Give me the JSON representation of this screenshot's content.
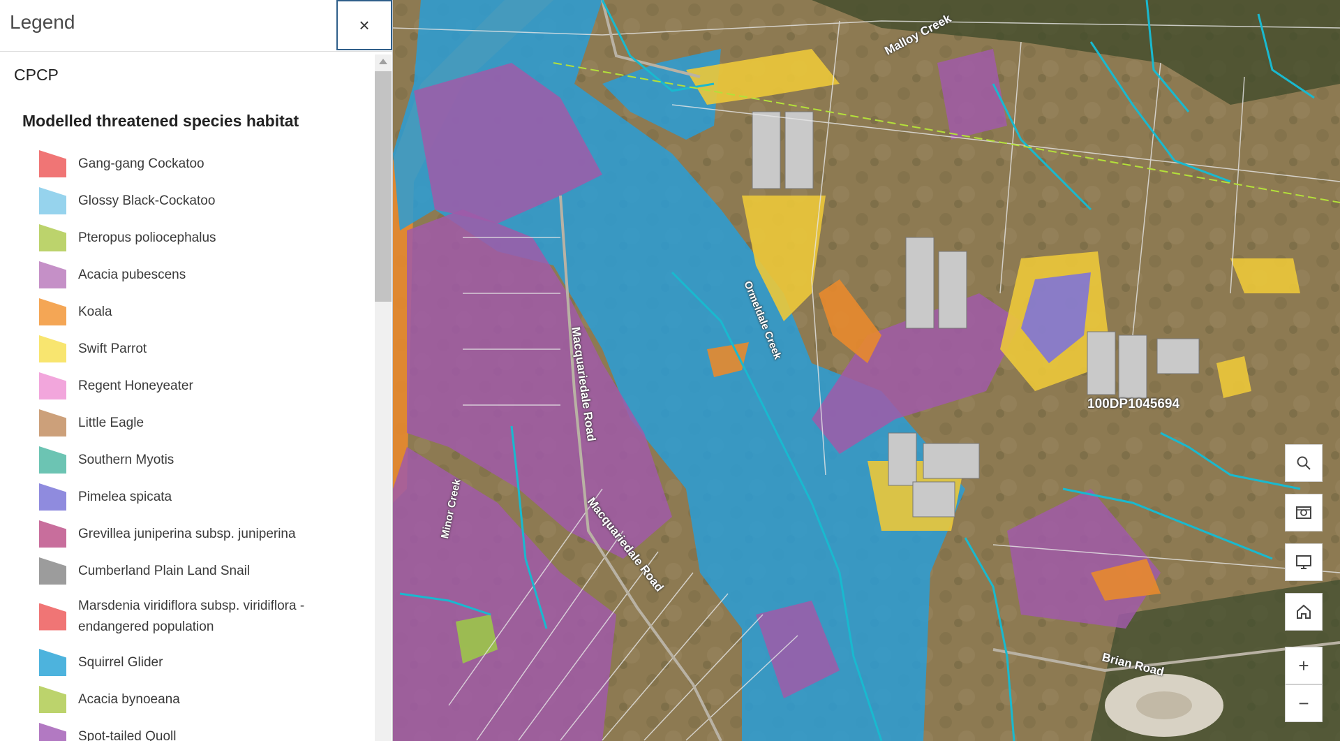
{
  "panel": {
    "title": "Legend",
    "close_label": "×",
    "layer_title": "CPCP",
    "group_title": "Modelled threatened species habitat"
  },
  "legend_items": [
    {
      "label": "Gang-gang Cockatoo",
      "color": "#f07575"
    },
    {
      "label": "Glossy Black-Cockatoo",
      "color": "#96d3ed"
    },
    {
      "label": "Pteropus poliocephalus",
      "color": "#bcd36c"
    },
    {
      "label": "Acacia pubescens",
      "color": "#c590c7"
    },
    {
      "label": "Koala",
      "color": "#f4a655"
    },
    {
      "label": "Swift Parrot",
      "color": "#f8e56f"
    },
    {
      "label": "Regent Honeyeater",
      "color": "#f2a6dc"
    },
    {
      "label": "Little Eagle",
      "color": "#cca07a"
    },
    {
      "label": "Southern Myotis",
      "color": "#6cc4b3"
    },
    {
      "label": "Pimelea spicata",
      "color": "#8f8bde"
    },
    {
      "label": "Grevillea juniperina subsp. juniperina",
      "color": "#c86e9c"
    },
    {
      "label": "Cumberland Plain Land Snail",
      "color": "#9c9c9c"
    },
    {
      "label": "Marsdenia viridiflora subsp. viridiflora - endangered population",
      "color": "#f07575"
    },
    {
      "label": "Squirrel Glider",
      "color": "#4db3dd"
    },
    {
      "label": "Acacia bynoeana",
      "color": "#bcd36c"
    },
    {
      "label": "Spot-tailed Quoll",
      "color": "#b279c2"
    }
  ],
  "map": {
    "labels": {
      "malloy_creek": "Malloy Creek",
      "ormeldale_creek": "Ormeldale Creek",
      "macquariedale_road_1": "Macquariedale Road",
      "macquariedale_road_2": "Macquariedale Road",
      "lot_label": "100DP1045694",
      "brian_road": "Brian Road",
      "minor_creek": "Minor Creek"
    }
  },
  "controls": {
    "search_icon": "search-icon",
    "basemap_icon": "basemap-gallery-icon",
    "fullscreen_icon": "monitor-icon",
    "home_icon": "home-icon",
    "zoom_in_label": "+",
    "zoom_out_label": "−"
  }
}
